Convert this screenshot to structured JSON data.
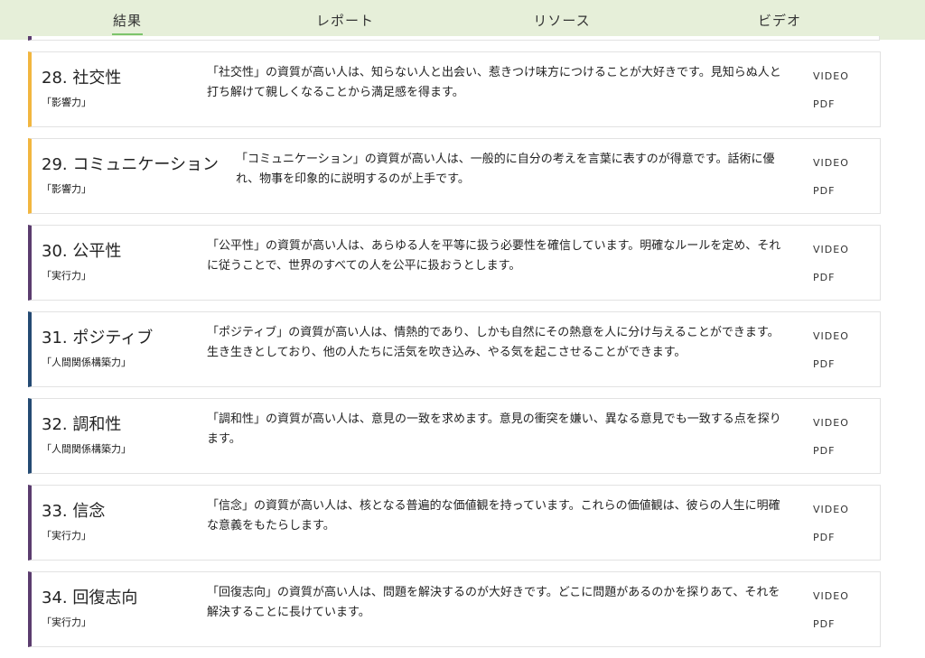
{
  "nav": {
    "tabs": [
      {
        "label": "結果",
        "active": true
      },
      {
        "label": "レポート",
        "active": false
      },
      {
        "label": "リソース",
        "active": false
      },
      {
        "label": "ビデオ",
        "active": false
      }
    ]
  },
  "colors": {
    "influence": "#f2b63f",
    "executing": "#5b3c6e",
    "relationship": "#244a73",
    "nav_bg": "#e6efd9",
    "active_underline": "#7cc46b"
  },
  "cards": [
    {
      "title": "28. 社交性",
      "category": "「影響力」",
      "color": "#f2b63f",
      "desc": "「社交性」の資質が高い人は、知らない人と出会い、惹きつけ味方につけることが大好きです。見知らぬ人と打ち解けて親しくなることから満足感を得ます。",
      "video": "VIDEO",
      "pdf": "PDF"
    },
    {
      "title": "29. コミュニケーション",
      "category": "「影響力」",
      "color": "#f2b63f",
      "wide": true,
      "desc": "「コミュニケーション」の資質が高い人は、一般的に自分の考えを言葉に表すのが得意です。話術に優れ、物事を印象的に説明するのが上手です。",
      "video": "VIDEO",
      "pdf": "PDF"
    },
    {
      "title": "30. 公平性",
      "category": "「実行力」",
      "color": "#5b3c6e",
      "desc": "「公平性」の資質が高い人は、あらゆる人を平等に扱う必要性を確信しています。明確なルールを定め、それに従うことで、世界のすべての人を公平に扱おうとします。",
      "video": "VIDEO",
      "pdf": "PDF"
    },
    {
      "title": "31. ポジティブ",
      "category": "「人間関係構築力」",
      "color": "#244a73",
      "desc": "「ポジティブ」の資質が高い人は、情熱的であり、しかも自然にその熱意を人に分け与えることができます。生き生きとしており、他の人たちに活気を吹き込み、やる気を起こさせることができます。",
      "video": "VIDEO",
      "pdf": "PDF"
    },
    {
      "title": "32. 調和性",
      "category": "「人間関係構築力」",
      "color": "#244a73",
      "desc": "「調和性」の資質が高い人は、意見の一致を求めます。意見の衝突を嫌い、異なる意見でも一致する点を探ります。",
      "video": "VIDEO",
      "pdf": "PDF"
    },
    {
      "title": "33. 信念",
      "category": "「実行力」",
      "color": "#5b3c6e",
      "desc": "「信念」の資質が高い人は、核となる普遍的な価値観を持っています。これらの価値観は、彼らの人生に明確な意義をもたらします。",
      "video": "VIDEO",
      "pdf": "PDF"
    },
    {
      "title": "34. 回復志向",
      "category": "「実行力」",
      "color": "#5b3c6e",
      "desc": "「回復志向」の資質が高い人は、問題を解決するのが大好きです。どこに問題があるのかを探りあて、それを解決することに長けています。",
      "video": "VIDEO",
      "pdf": "PDF"
    }
  ]
}
